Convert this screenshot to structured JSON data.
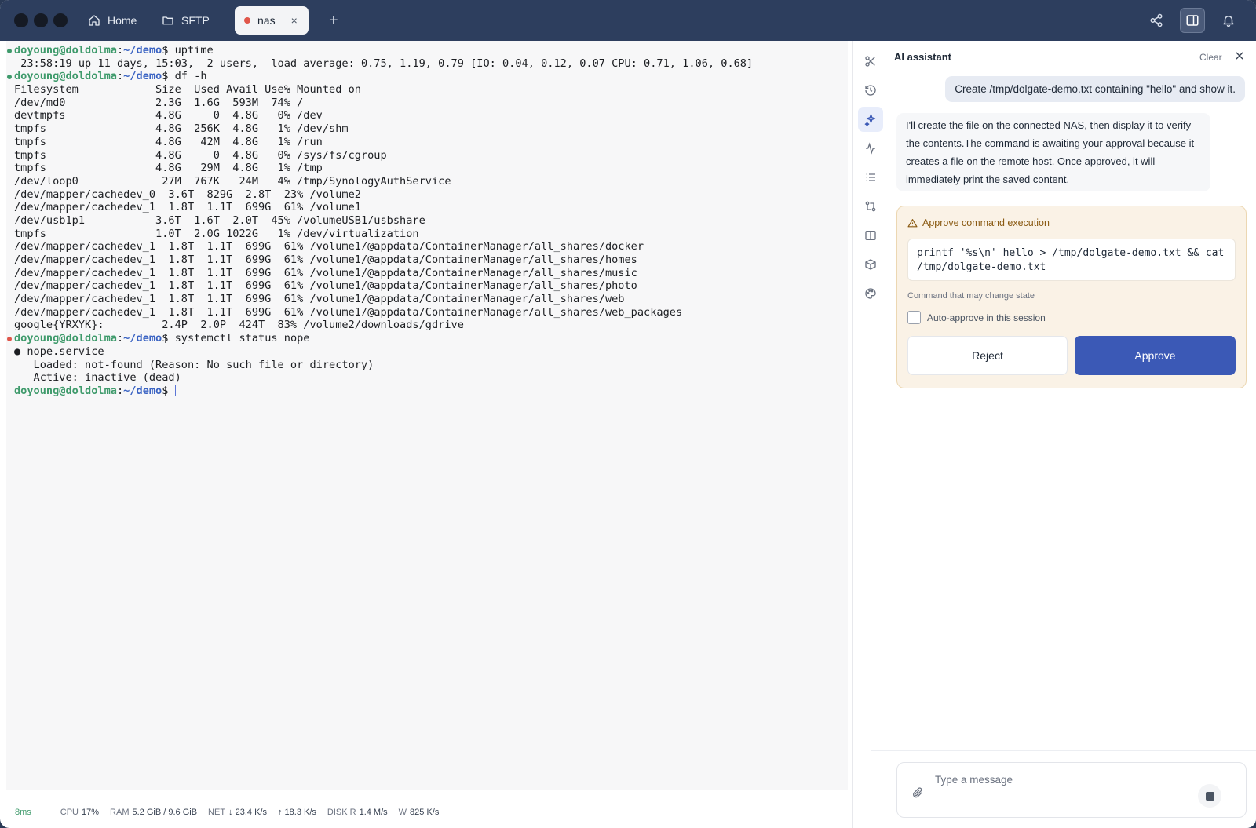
{
  "tabs": [
    {
      "label": "Home",
      "icon": "home-icon"
    },
    {
      "label": "SFTP",
      "icon": "folder-icon"
    },
    {
      "label": "nas",
      "icon": "status-dot",
      "active": true,
      "status_color": "#e0564a"
    }
  ],
  "add_tab_label": "+",
  "close_tab_label": "×",
  "terminal": {
    "prompt_user": "doyoung@doldolma",
    "prompt_sep": ":",
    "prompt_path": "~/demo",
    "prompt_suffix": "$ ",
    "lines": [
      {
        "kind": "prompt",
        "cmd": "uptime",
        "dot": "#3e9a6b"
      },
      {
        "kind": "out",
        "text": " 23:58:19 up 11 days, 15:03,  2 users,  load average: 0.75, 1.19, 0.79 [IO: 0.04, 0.12, 0.07 CPU: 0.71, 1.06, 0.68]"
      },
      {
        "kind": "prompt",
        "cmd": "df -h",
        "dot": "#3e9a6b"
      },
      {
        "kind": "out",
        "text": "Filesystem            Size  Used Avail Use% Mounted on"
      },
      {
        "kind": "out",
        "text": "/dev/md0              2.3G  1.6G  593M  74% /"
      },
      {
        "kind": "out",
        "text": "devtmpfs              4.8G     0  4.8G   0% /dev"
      },
      {
        "kind": "out",
        "text": "tmpfs                 4.8G  256K  4.8G   1% /dev/shm"
      },
      {
        "kind": "out",
        "text": "tmpfs                 4.8G   42M  4.8G   1% /run"
      },
      {
        "kind": "out",
        "text": "tmpfs                 4.8G     0  4.8G   0% /sys/fs/cgroup"
      },
      {
        "kind": "out",
        "text": "tmpfs                 4.8G   29M  4.8G   1% /tmp"
      },
      {
        "kind": "out",
        "text": "/dev/loop0             27M  767K   24M   4% /tmp/SynologyAuthService"
      },
      {
        "kind": "out",
        "text": "/dev/mapper/cachedev_0  3.6T  829G  2.8T  23% /volume2"
      },
      {
        "kind": "out",
        "text": "/dev/mapper/cachedev_1  1.8T  1.1T  699G  61% /volume1"
      },
      {
        "kind": "out",
        "text": "/dev/usb1p1           3.6T  1.6T  2.0T  45% /volumeUSB1/usbshare"
      },
      {
        "kind": "out",
        "text": "tmpfs                 1.0T  2.0G 1022G   1% /dev/virtualization"
      },
      {
        "kind": "out",
        "text": "/dev/mapper/cachedev_1  1.8T  1.1T  699G  61% /volume1/@appdata/ContainerManager/all_shares/docker"
      },
      {
        "kind": "out",
        "text": "/dev/mapper/cachedev_1  1.8T  1.1T  699G  61% /volume1/@appdata/ContainerManager/all_shares/homes"
      },
      {
        "kind": "out",
        "text": "/dev/mapper/cachedev_1  1.8T  1.1T  699G  61% /volume1/@appdata/ContainerManager/all_shares/music"
      },
      {
        "kind": "out",
        "text": "/dev/mapper/cachedev_1  1.8T  1.1T  699G  61% /volume1/@appdata/ContainerManager/all_shares/photo"
      },
      {
        "kind": "out",
        "text": "/dev/mapper/cachedev_1  1.8T  1.1T  699G  61% /volume1/@appdata/ContainerManager/all_shares/web"
      },
      {
        "kind": "out",
        "text": "/dev/mapper/cachedev_1  1.8T  1.1T  699G  61% /volume1/@appdata/ContainerManager/all_shares/web_packages"
      },
      {
        "kind": "out",
        "text": "google{YRXYK}:         2.4P  2.0P  424T  83% /volume2/downloads/gdrive"
      },
      {
        "kind": "prompt",
        "cmd": "systemctl status nope",
        "dot": "#e0564a"
      },
      {
        "kind": "out",
        "text": "● nope.service"
      },
      {
        "kind": "out",
        "text": "   Loaded: not-found (Reason: No such file or directory)"
      },
      {
        "kind": "out",
        "text": "   Active: inactive (dead)"
      },
      {
        "kind": "prompt",
        "cmd": "",
        "cursor": true
      }
    ]
  },
  "statusbar": {
    "ping": "8ms",
    "cpu_label": "CPU",
    "cpu_value": "17%",
    "ram_label": "RAM",
    "ram_value": "5.2 GiB / 9.6 GiB",
    "net_label": "NET",
    "net_down": "↓ 23.4 K/s",
    "net_up": "↑ 18.3 K/s",
    "disk_label": "DISK R",
    "disk_read": "1.4 M/s",
    "disk_w_label": "W",
    "disk_write": "825 K/s"
  },
  "rail": [
    "scissors-icon",
    "history-icon",
    "ai-sparkle-icon",
    "activity-icon",
    "list-icon",
    "git-compare-icon",
    "columns-icon",
    "package-icon",
    "palette-icon"
  ],
  "assistant": {
    "title": "AI assistant",
    "clear_label": "Clear",
    "user_message": "Create /tmp/dolgate-demo.txt containing \"hello\" and show it.",
    "ai_message": "I'll create the file on the connected NAS, then display it to verify the contents.The command is awaiting your approval because it creates a file on the remote host. Once approved, it will immediately print the saved content.",
    "approval": {
      "title": "Approve command execution",
      "command": "printf '%s\\n' hello > /tmp/dolgate-demo.txt && cat /tmp/dolgate-demo.txt",
      "note": "Command that may change state",
      "auto_approve_label": "Auto-approve in this session",
      "reject_label": "Reject",
      "approve_label": "Approve"
    },
    "composer_placeholder": "Type a message"
  },
  "colors": {
    "accent": "#3b59b6",
    "titlebar": "#2d3e5e",
    "prompt_user": "#3e9a6b",
    "prompt_path": "#3a63c3"
  }
}
